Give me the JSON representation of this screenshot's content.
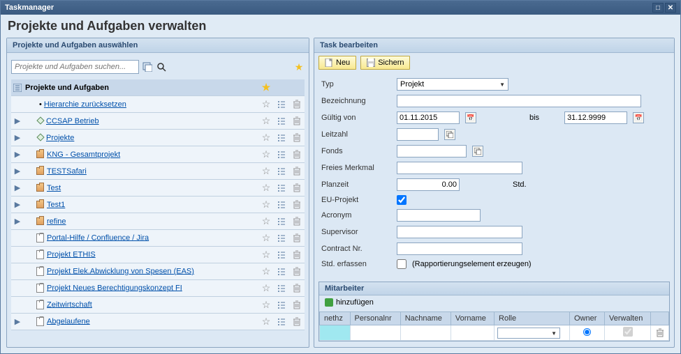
{
  "window": {
    "title": "Taskmanager"
  },
  "page": {
    "title": "Projekte und Aufgaben verwalten"
  },
  "left": {
    "title": "Projekte und Aufgaben auswählen",
    "search_placeholder": "Projekte und Aufgaben suchen...",
    "root": "Projekte und Aufgaben",
    "items": [
      {
        "label": "Hierarchie zurücksetzen",
        "type": "reset",
        "expand": ""
      },
      {
        "label": "CCSAP Betrieb",
        "type": "diamond",
        "expand": "▶"
      },
      {
        "label": "Projekte",
        "type": "diamond",
        "expand": "▶"
      },
      {
        "label": "KNG - Gesamtprojekt",
        "type": "hier",
        "expand": "▶"
      },
      {
        "label": "TESTSafari",
        "type": "hier",
        "expand": "▶"
      },
      {
        "label": "Test",
        "type": "hier",
        "expand": "▶"
      },
      {
        "label": "Test1",
        "type": "hier",
        "expand": "▶"
      },
      {
        "label": "refine",
        "type": "hier",
        "expand": "▶"
      },
      {
        "label": "Portal-Hilfe / Confluence / Jira",
        "type": "clip",
        "expand": ""
      },
      {
        "label": "Projekt ETHIS",
        "type": "clip",
        "expand": ""
      },
      {
        "label": "Projekt Elek.Abwicklung von Spesen (EAS)",
        "type": "clip",
        "expand": ""
      },
      {
        "label": "Projekt Neues Berechtigungskonzept FI",
        "type": "clip",
        "expand": ""
      },
      {
        "label": "Zeitwirtschaft",
        "type": "clip",
        "expand": ""
      },
      {
        "label": "Abgelaufene",
        "type": "clip",
        "expand": "▶"
      }
    ]
  },
  "right": {
    "title": "Task bearbeiten",
    "btn_new": "Neu",
    "btn_save": "Sichern",
    "labels": {
      "typ": "Typ",
      "bez": "Bezeichnung",
      "von": "Gültig von",
      "bis": "bis",
      "leit": "Leitzahl",
      "fonds": "Fonds",
      "merk": "Freies Merkmal",
      "planz": "Planzeit",
      "std": "Std.",
      "eu": "EU-Projekt",
      "acro": "Acronym",
      "sup": "Supervisor",
      "cnr": "Contract Nr.",
      "erf": "Std. erfassen",
      "erf_note": "(Rapportierungselement erzeugen)"
    },
    "values": {
      "typ": "Projekt",
      "von": "01.11.2015",
      "bis": "31.12.9999",
      "planz": "0.00",
      "eu_checked": true
    },
    "emp": {
      "title": "Mitarbeiter",
      "add": "hinzufügen",
      "cols": {
        "nethz": "nethz",
        "pers": "Personalnr",
        "nach": "Nachname",
        "vor": "Vorname",
        "rolle": "Rolle",
        "owner": "Owner",
        "verw": "Verwalten"
      }
    }
  }
}
